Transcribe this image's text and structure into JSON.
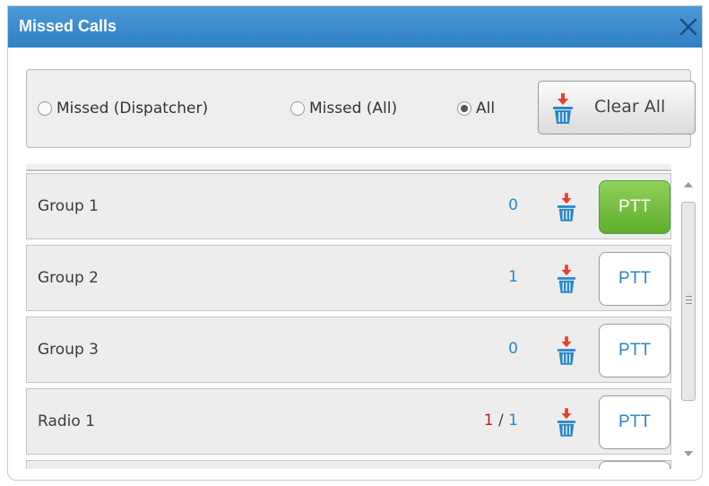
{
  "window": {
    "title": "Missed Calls"
  },
  "filters": {
    "options": [
      {
        "label": "Missed (Dispatcher)",
        "checked": false
      },
      {
        "label": "Missed (All)",
        "checked": false
      },
      {
        "label": "All",
        "checked": true
      }
    ],
    "clear_all_label": "Clear All"
  },
  "rows": [
    {
      "name": "Group 1",
      "count": "0",
      "ptt_label": "PTT",
      "ptt_active": true
    },
    {
      "name": "Group 2",
      "count": "1",
      "ptt_label": "PTT",
      "ptt_active": false
    },
    {
      "name": "Group 3",
      "count": "0",
      "ptt_label": "PTT",
      "ptt_active": false
    },
    {
      "name": "Radio 1",
      "count_missed": "1",
      "count_sep": "/",
      "count_total": "1",
      "ptt_label": "PTT",
      "ptt_active": false
    }
  ],
  "colors": {
    "title_bar": "#3a88cc",
    "count_blue": "#2a86cc",
    "count_red": "#c8191b",
    "ptt_active": "#6dbb3a"
  },
  "icons": {
    "close": "close-icon",
    "trash": "trash-icon"
  }
}
